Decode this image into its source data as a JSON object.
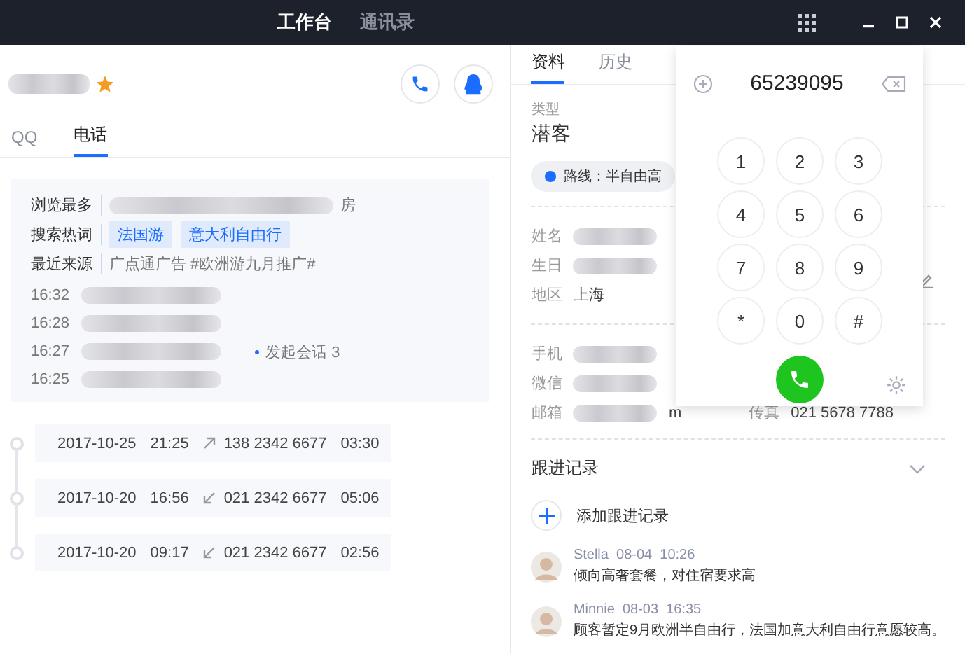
{
  "top_tabs": [
    {
      "label": "工作台",
      "selected": true
    },
    {
      "label": "通讯录",
      "selected": false
    }
  ],
  "contact": {
    "starred": true,
    "tabs": [
      {
        "label": "QQ",
        "selected": false
      },
      {
        "label": "电话",
        "selected": true
      }
    ]
  },
  "info": {
    "rows": [
      {
        "label": "浏览最多",
        "kind": "blurred",
        "value": "房"
      },
      {
        "label": "搜索热词",
        "kind": "tags",
        "tags": [
          "法国游",
          "意大利自由行"
        ]
      },
      {
        "label": "最近来源",
        "kind": "text",
        "value": "广点通广告  #欧洲游九月推广#"
      }
    ],
    "sessions": [
      {
        "time": "16:32"
      },
      {
        "time": "16:28"
      },
      {
        "time": "16:27",
        "note": "发起会话  3"
      },
      {
        "time": "16:25"
      }
    ]
  },
  "calls": [
    {
      "date": "2017-10-25",
      "time": "21:25",
      "kind": "outgoing",
      "number": "138 2342 6677",
      "duration": "03:30"
    },
    {
      "date": "2017-10-20",
      "time": "16:56",
      "kind": "incoming",
      "number": "021 2342 6677",
      "duration": "05:06"
    },
    {
      "date": "2017-10-20",
      "time": "09:17",
      "kind": "incoming",
      "number": "021 2342 6677",
      "duration": "02:56"
    }
  ],
  "detail": {
    "tabs": [
      {
        "label": "资料",
        "selected": true
      },
      {
        "label": "历史",
        "selected": false
      }
    ],
    "type_label": "类型",
    "type_value": "潜客",
    "route": "路线：半自由高",
    "groups": [
      [
        {
          "label": "姓名",
          "blurred": true
        },
        {
          "label": "生日",
          "blurred": true
        },
        {
          "label": "地区",
          "value": "上海"
        }
      ],
      [
        {
          "label": "手机",
          "blurred": true
        },
        {
          "label": "微信",
          "blurred": true
        },
        {
          "label": "邮箱",
          "blurred": true,
          "value": "m",
          "extra_label": "传真",
          "extra_value": "021 5678 7788"
        }
      ]
    ],
    "follow": {
      "title": "跟进记录",
      "add": "添加跟进记录",
      "notes": [
        {
          "author": "Stella",
          "date": "08-04",
          "time": "10:26",
          "text": "倾向高奢套餐，对住宿要求高"
        },
        {
          "author": "Minnie",
          "date": "08-03",
          "time": "16:35",
          "text": "顾客暂定9月欧洲半自由行，法国加意大利自由行意愿较高。"
        }
      ]
    }
  },
  "dialer": {
    "number": "65239095",
    "keys": [
      "1",
      "2",
      "3",
      "4",
      "5",
      "6",
      "7",
      "8",
      "9",
      "*",
      "0",
      "#"
    ]
  }
}
